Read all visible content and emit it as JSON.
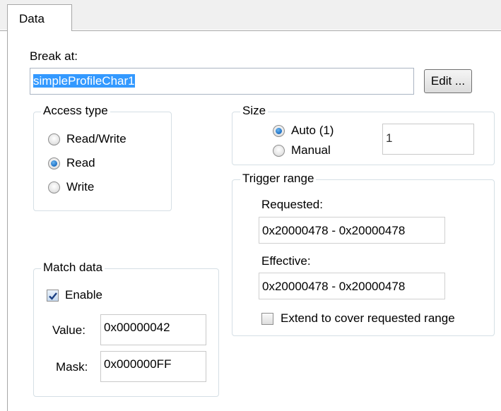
{
  "tab": {
    "label": "Data"
  },
  "break_at": {
    "label": "Break at:",
    "value": "simpleProfileChar1",
    "edit_button": "Edit ..."
  },
  "access_type": {
    "legend": "Access type",
    "options": [
      "Read/Write",
      "Read",
      "Write"
    ],
    "selected": "Read"
  },
  "size": {
    "legend": "Size",
    "options": [
      "Auto (1)",
      "Manual"
    ],
    "selected": "Auto (1)",
    "value": "1"
  },
  "trigger_range": {
    "legend": "Trigger range",
    "requested_label": "Requested:",
    "requested_value": "0x20000478 - 0x20000478",
    "effective_label": "Effective:",
    "effective_value": "0x20000478 - 0x20000478",
    "extend_label": "Extend to cover requested range",
    "extend_checked": false
  },
  "match_data": {
    "legend": "Match data",
    "enable_label": "Enable",
    "enable_checked": true,
    "value_label": "Value:",
    "value": "0x00000042",
    "mask_label": "Mask:",
    "mask": "0x000000FF"
  }
}
